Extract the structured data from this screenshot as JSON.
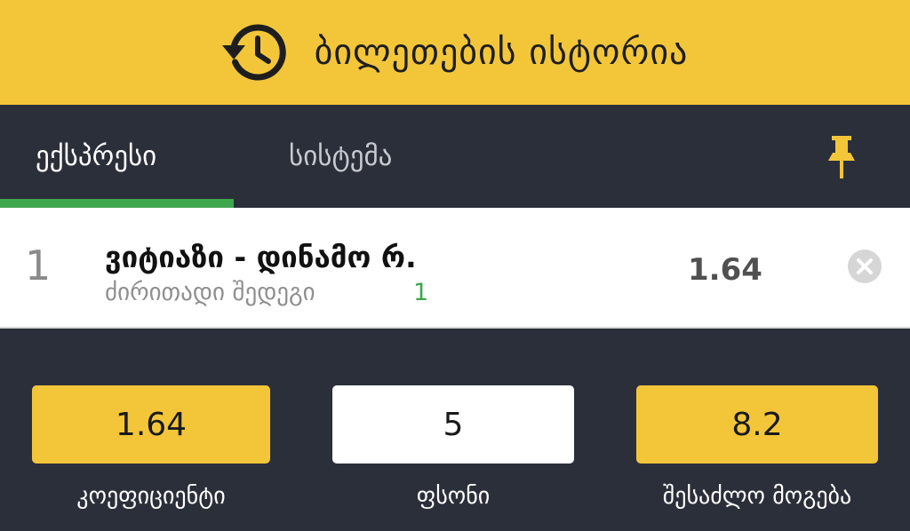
{
  "header": {
    "title": "ბილეთების ისტორია",
    "icon": "history-icon"
  },
  "tabs": [
    {
      "label": "ექსპრესი",
      "active": true
    },
    {
      "label": "სისტემა",
      "active": false
    }
  ],
  "pin": {
    "icon": "pin-icon"
  },
  "colors": {
    "accent": "#f3c63a",
    "background": "#2b2f3a",
    "active_tab": "#3ea64d",
    "selection": "#3ea64d"
  },
  "bet": {
    "index": "1",
    "match": "ვიტიაზი - დინამო რ.",
    "market": "ძირითადი შედეგი",
    "selection": "1",
    "odd": "1.64"
  },
  "summary": {
    "coefficient": {
      "value": "1.64",
      "label": "კოეფიციენტი"
    },
    "stake": {
      "value": "5",
      "label": "ფსონი"
    },
    "possible_win": {
      "value": "8.2",
      "label": "შესაძლო მოგება"
    }
  }
}
